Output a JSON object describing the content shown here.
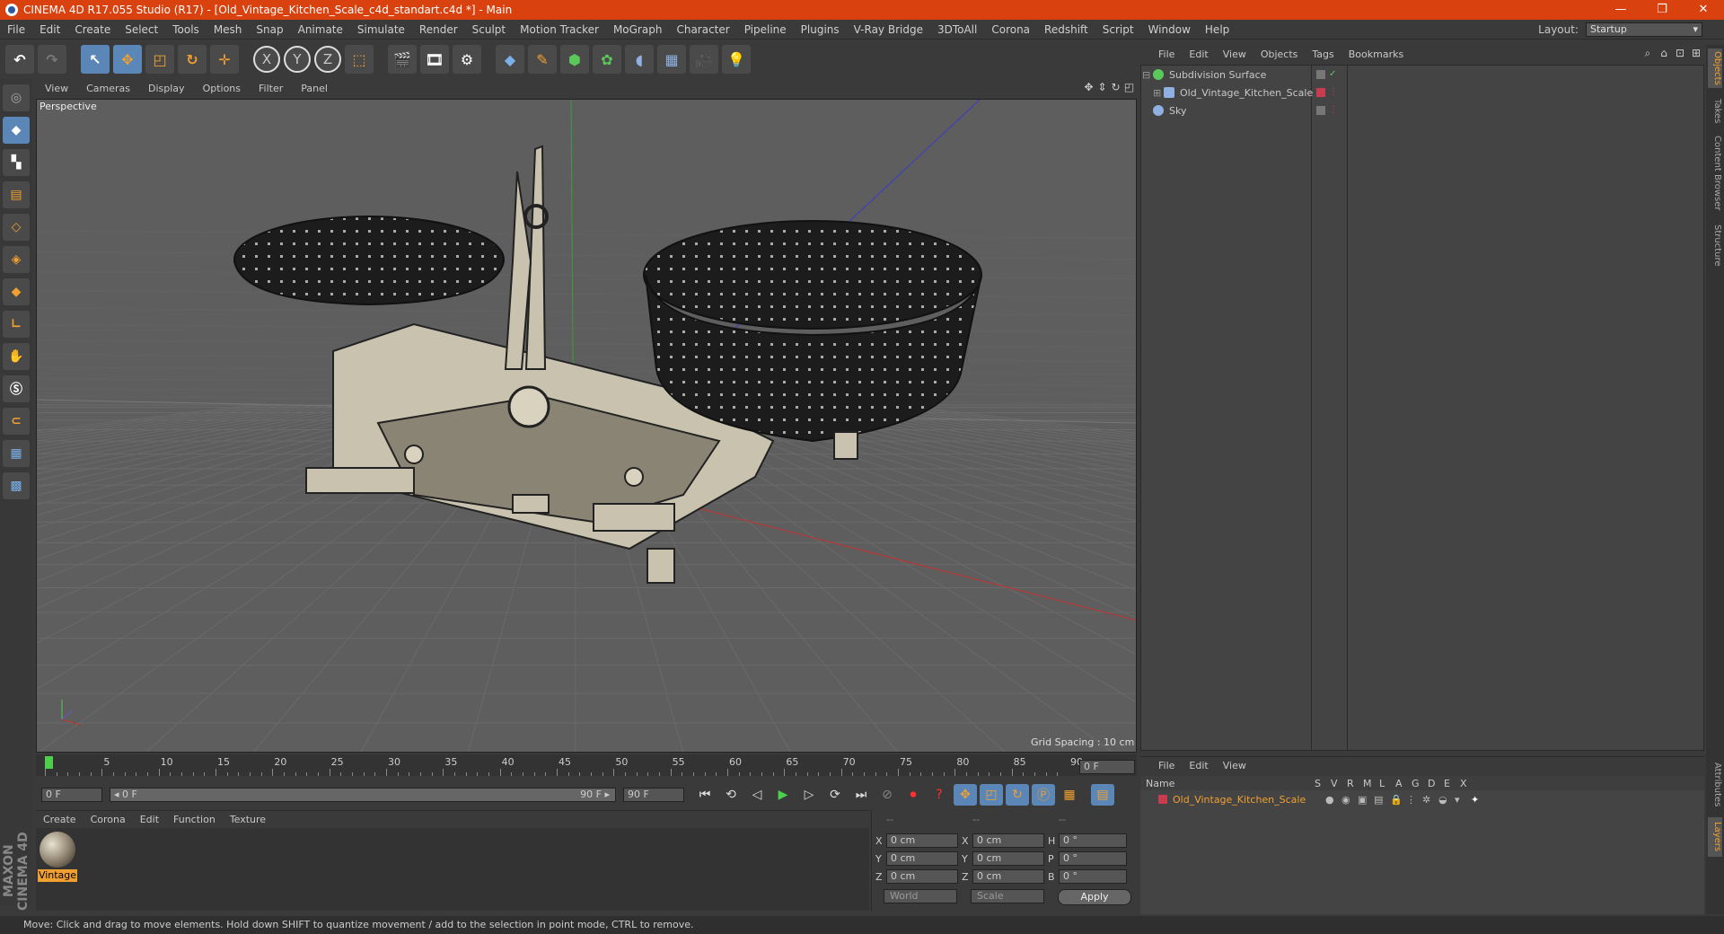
{
  "window": {
    "title": "CINEMA 4D R17.055 Studio (R17) - [Old_Vintage_Kitchen_Scale_c4d_standart.c4d *] - Main",
    "controls": [
      "—",
      "❐",
      "✕"
    ]
  },
  "menubar": {
    "items": [
      "File",
      "Edit",
      "Create",
      "Select",
      "Tools",
      "Mesh",
      "Snap",
      "Animate",
      "Simulate",
      "Render",
      "Sculpt",
      "Motion Tracker",
      "MoGraph",
      "Character",
      "Pipeline",
      "Plugins",
      "V-Ray Bridge",
      "3DToAll",
      "Corona",
      "Redshift",
      "Script",
      "Window",
      "Help"
    ],
    "layout_label": "Layout:",
    "layout_value": "Startup"
  },
  "toolbar": {
    "axis_x": "X",
    "axis_y": "Y",
    "axis_z": "Z"
  },
  "viewport": {
    "menu": [
      "View",
      "Cameras",
      "Display",
      "Options",
      "Filter",
      "Panel"
    ],
    "label": "Perspective",
    "grid_spacing": "Grid Spacing : 10 cm"
  },
  "timeline": {
    "ticks": [
      "0",
      "5",
      "10",
      "15",
      "20",
      "25",
      "30",
      "35",
      "40",
      "45",
      "50",
      "55",
      "60",
      "65",
      "70",
      "75",
      "80",
      "85",
      "90"
    ],
    "current_frame": "0 F",
    "start_field": "0 F",
    "range_start": "◂ 0 F",
    "range_end": "90 F ▸",
    "end_field": "90 F"
  },
  "materials": {
    "menu": [
      "Create",
      "Corona",
      "Edit",
      "Function",
      "Texture"
    ],
    "items": [
      {
        "name": "Vintage"
      }
    ]
  },
  "coordinates": {
    "header": [
      "--",
      "--",
      "--"
    ],
    "rows": [
      {
        "a": "X",
        "av": "0 cm",
        "b": "X",
        "bv": "0 cm",
        "c": "H",
        "cv": "0 °"
      },
      {
        "a": "Y",
        "av": "0 cm",
        "b": "Y",
        "bv": "0 cm",
        "c": "P",
        "cv": "0 °"
      },
      {
        "a": "Z",
        "av": "0 cm",
        "b": "Z",
        "bv": "0 cm",
        "c": "B",
        "cv": "0 °"
      }
    ],
    "mode": "World",
    "type": "Scale",
    "apply": "Apply"
  },
  "status": {
    "text": "Move: Click and drag to move elements. Hold down SHIFT to quantize movement / add to the selection in point mode, CTRL to remove."
  },
  "objects": {
    "menu": [
      "File",
      "Edit",
      "View",
      "Objects",
      "Tags",
      "Bookmarks"
    ],
    "items": [
      {
        "name": "Subdivision Surface",
        "color": "#5ac85a"
      },
      {
        "name": "Old_Vintage_Kitchen_Scale",
        "color": "#8fb0e0"
      },
      {
        "name": "Sky",
        "color": "#8fb0e0"
      }
    ]
  },
  "layers": {
    "menu": [
      "File",
      "Edit",
      "View"
    ],
    "columns": [
      "Name",
      "S",
      "V",
      "R",
      "M",
      "L",
      "A",
      "G",
      "D",
      "E",
      "X"
    ],
    "items": [
      {
        "name": "Old_Vintage_Kitchen_Scale",
        "color": "#c83c50"
      }
    ]
  },
  "right_tabs": [
    "Objects",
    "Takes",
    "Content Browser",
    "Structure",
    "Attributes",
    "Layers"
  ],
  "left_logo": "MAXON CINEMA 4D",
  "colors": {
    "titlebar": "#d9410f",
    "accent": "#f0a030",
    "selected": "#5a86b8"
  }
}
